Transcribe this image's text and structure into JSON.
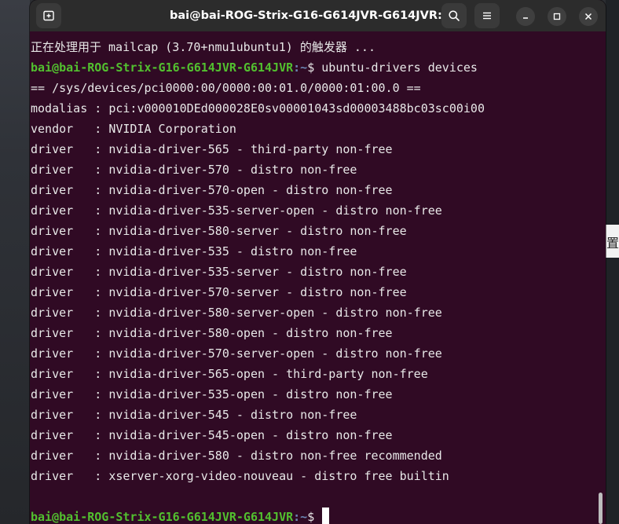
{
  "window": {
    "title": "bai@bai-ROG-Strix-G16-G614JVR-G614JVR: ~"
  },
  "background": {
    "right_panel_text": "置"
  },
  "prompt": {
    "user_host": "bai@bai-ROG-Strix-G16-G614JVR-G614JVR",
    "path": ":~",
    "symbol": "$"
  },
  "terminal": {
    "first_line": "正在处理用于 mailcap (3.70+nmu1ubuntu1) 的触发器 ...",
    "command": "ubuntu-drivers devices",
    "output": [
      "== /sys/devices/pci0000:00/0000:00:01.0/0000:01:00.0 ==",
      "modalias : pci:v000010DEd000028E0sv00001043sd00003488bc03sc00i00",
      "vendor   : NVIDIA Corporation",
      "driver   : nvidia-driver-565 - third-party non-free",
      "driver   : nvidia-driver-570 - distro non-free",
      "driver   : nvidia-driver-570-open - distro non-free",
      "driver   : nvidia-driver-535-server-open - distro non-free",
      "driver   : nvidia-driver-580-server - distro non-free",
      "driver   : nvidia-driver-535 - distro non-free",
      "driver   : nvidia-driver-535-server - distro non-free",
      "driver   : nvidia-driver-570-server - distro non-free",
      "driver   : nvidia-driver-580-server-open - distro non-free",
      "driver   : nvidia-driver-580-open - distro non-free",
      "driver   : nvidia-driver-570-server-open - distro non-free",
      "driver   : nvidia-driver-565-open - third-party non-free",
      "driver   : nvidia-driver-535-open - distro non-free",
      "driver   : nvidia-driver-545 - distro non-free",
      "driver   : nvidia-driver-545-open - distro non-free",
      "driver   : nvidia-driver-580 - distro non-free recommended",
      "driver   : xserver-xorg-video-nouveau - distro free builtin"
    ],
    "blank_line": ""
  },
  "icons": {
    "new_tab": "new-tab-icon",
    "search": "search-icon",
    "menu": "hamburger-menu-icon",
    "minimize": "minimize-icon",
    "maximize": "maximize-icon",
    "close": "close-icon"
  },
  "colors": {
    "terminal_bg": "#300a24",
    "titlebar_bg": "#2c2c2c",
    "prompt_user": "#52c02f",
    "prompt_path": "#6b86b3",
    "text": "#e8e8e8"
  }
}
